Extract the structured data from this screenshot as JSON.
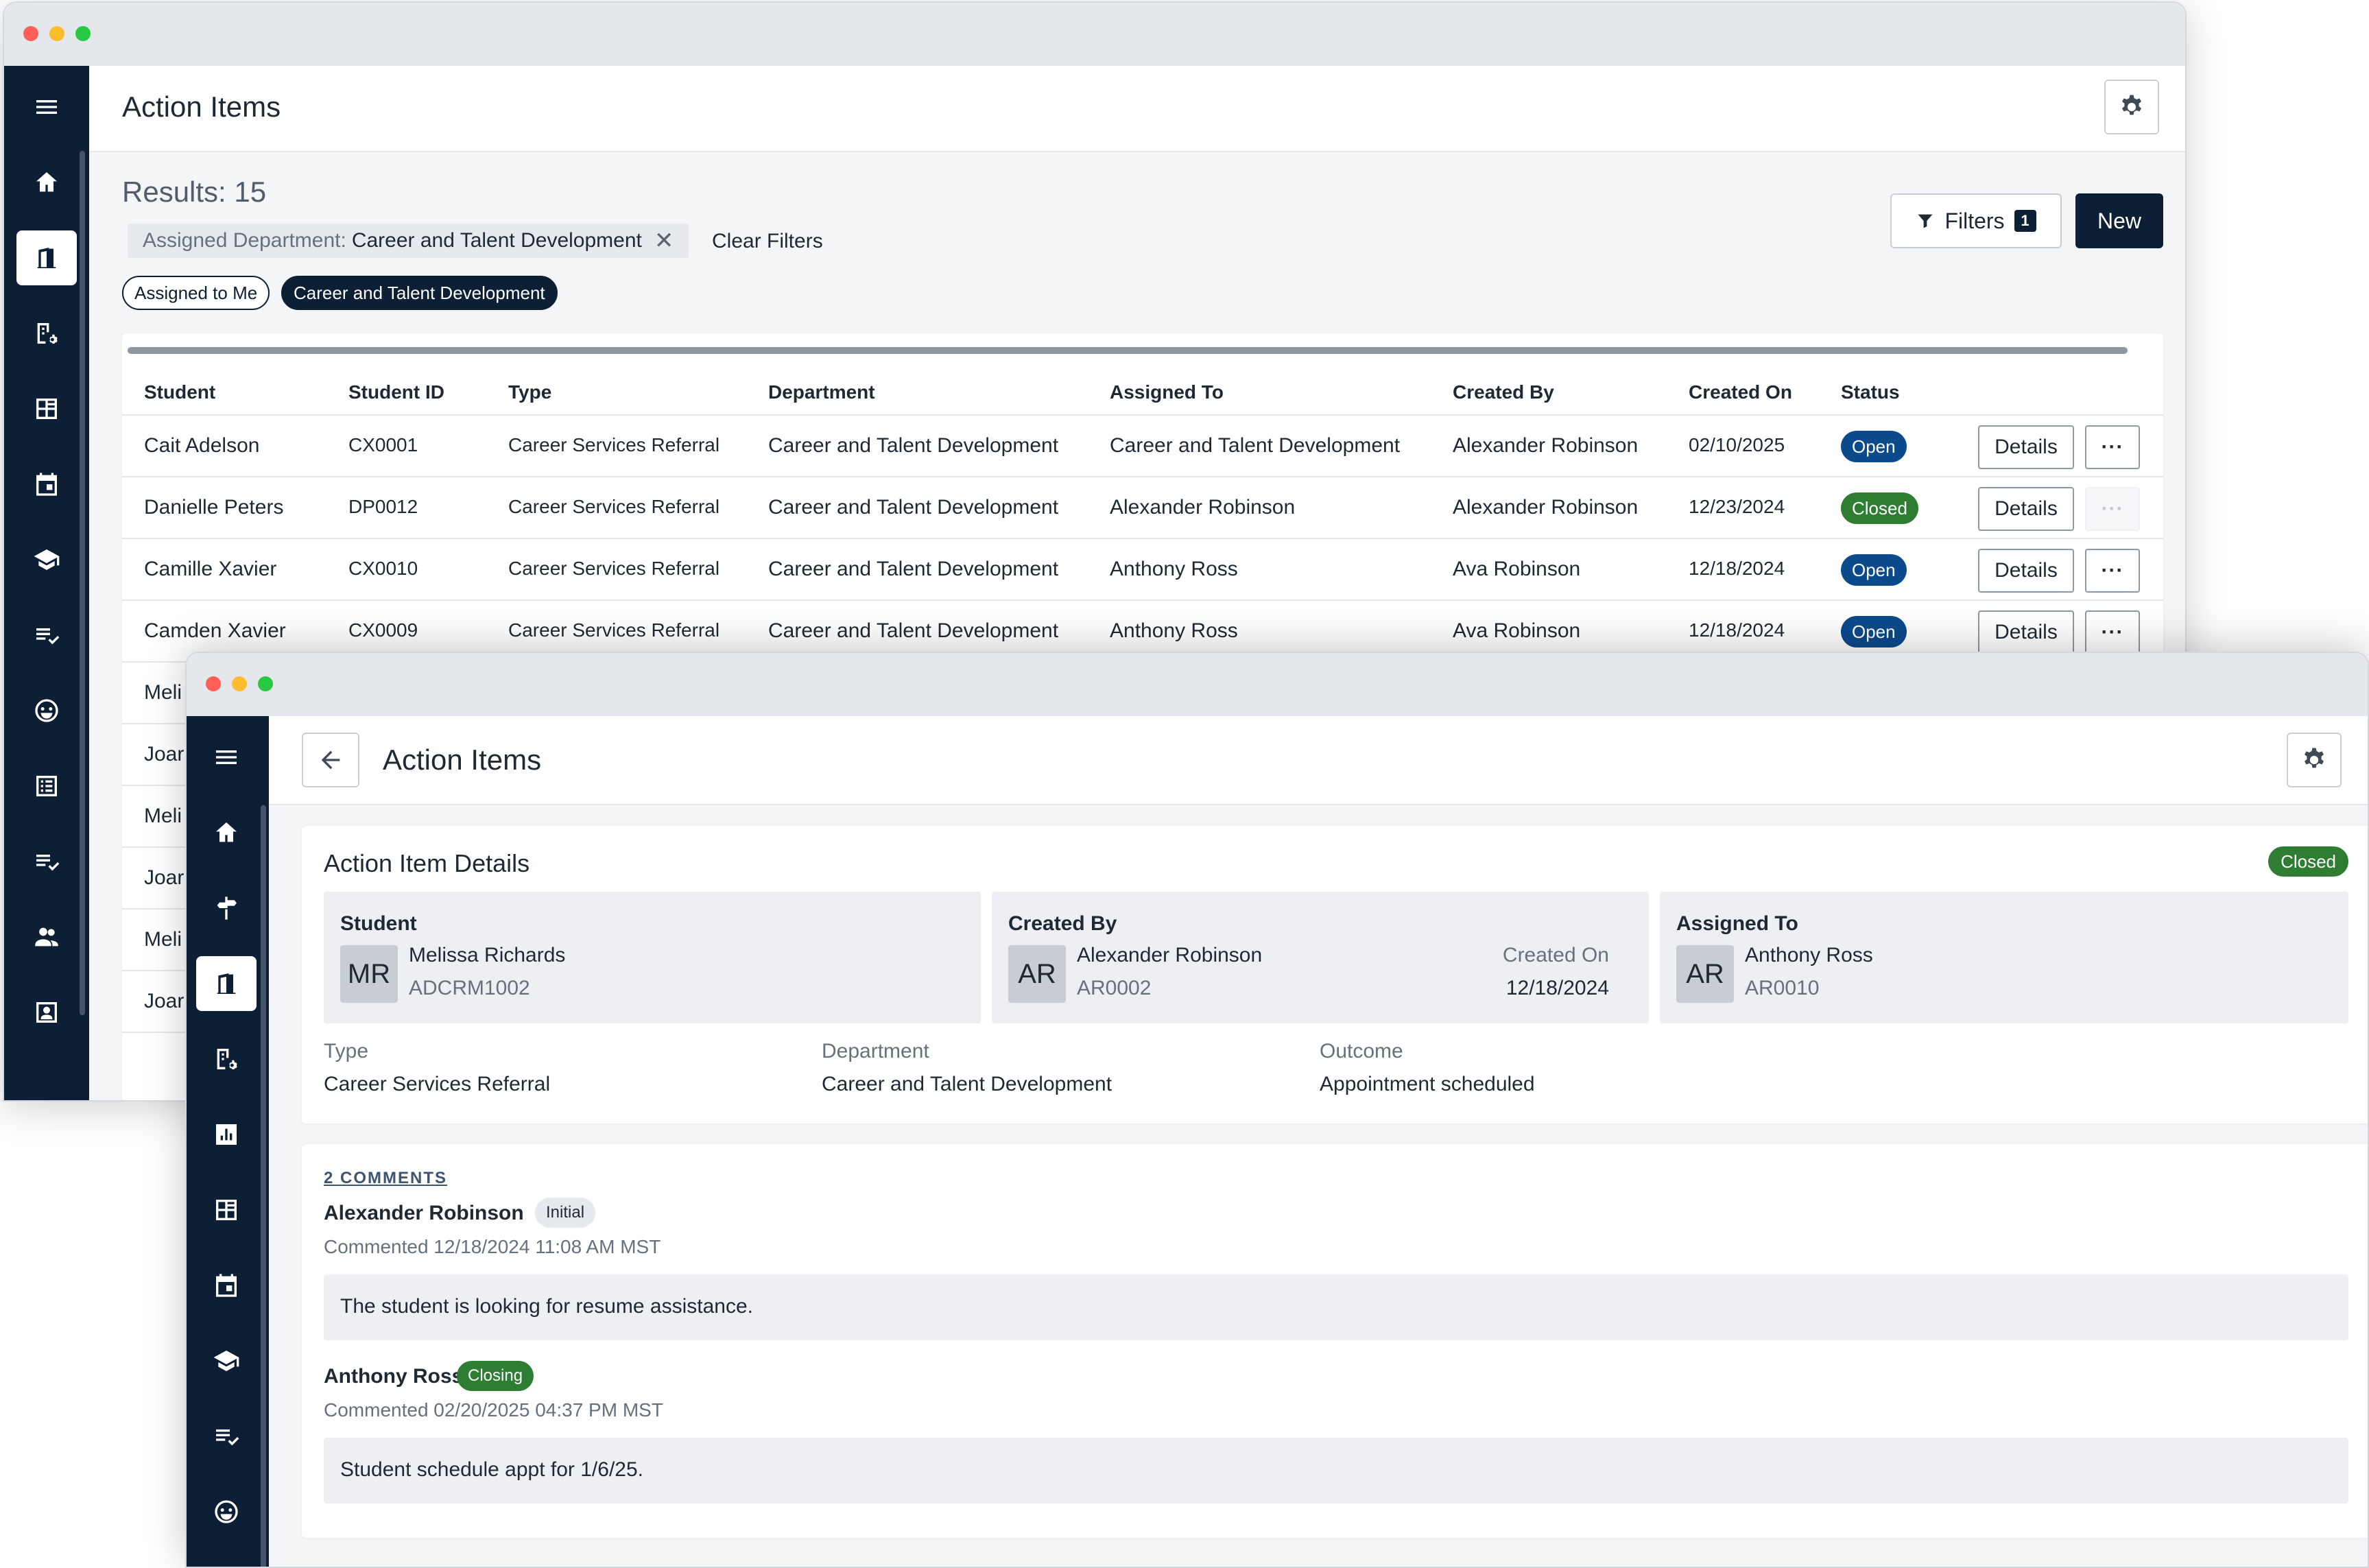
{
  "list_window": {
    "title": "Action Items",
    "results_label": "Results: 15",
    "active_filter": {
      "key": "Assigned Department:",
      "value": "Career and Talent Development",
      "remove_glyph": "✕"
    },
    "clear_filters_label": "Clear Filters",
    "quick_filters": [
      "Assigned to Me",
      "Career and Talent Development"
    ],
    "filters_button": {
      "label": "Filters",
      "count": "1"
    },
    "new_button_label": "New",
    "table": {
      "columns": [
        "Student",
        "Student ID",
        "Type",
        "Department",
        "Assigned To",
        "Created By",
        "Created On",
        "Status"
      ],
      "rows": [
        {
          "student": "Cait Adelson",
          "id": "CX0001",
          "type": "Career Services Referral",
          "department": "Career and Talent Development",
          "assigned_to": "Career and Talent Development",
          "created_by": "Alexander Robinson",
          "created_on": "02/10/2025",
          "status": "Open",
          "more_enabled": true
        },
        {
          "student": "Danielle Peters",
          "id": "DP0012",
          "type": "Career Services Referral",
          "department": "Career and Talent Development",
          "assigned_to": "Alexander Robinson",
          "created_by": "Alexander Robinson",
          "created_on": "12/23/2024",
          "status": "Closed",
          "more_enabled": false
        },
        {
          "student": "Camille Xavier",
          "id": "CX0010",
          "type": "Career Services Referral",
          "department": "Career and Talent Development",
          "assigned_to": "Anthony Ross",
          "created_by": "Ava Robinson",
          "created_on": "12/18/2024",
          "status": "Open",
          "more_enabled": true
        },
        {
          "student": "Camden Xavier",
          "id": "CX0009",
          "type": "Career Services Referral",
          "department": "Career and Talent Development",
          "assigned_to": "Anthony Ross",
          "created_by": "Ava Robinson",
          "created_on": "12/18/2024",
          "status": "Open",
          "more_enabled": true
        },
        {
          "student": "Meli"
        },
        {
          "student": "Joar"
        },
        {
          "student": "Meli"
        },
        {
          "student": "Joar"
        },
        {
          "student": "Meli"
        },
        {
          "student": "Joar"
        }
      ],
      "details_label": "Details",
      "more_label": "···"
    },
    "sidebar_icons": [
      "menu-icon",
      "home-icon",
      "door-icon",
      "building-gear-icon",
      "dashboard-icon",
      "calendar-icon",
      "graduation-cap-icon",
      "checklist-icon",
      "smiley-icon",
      "list-icon",
      "checklist-icon",
      "people-icon",
      "contact-card-icon"
    ]
  },
  "detail_window": {
    "title": "Action Items",
    "card_title": "Action Item Details",
    "status": "Closed",
    "student": {
      "label": "Student",
      "initials": "MR",
      "name": "Melissa Richards",
      "id": "ADCRM1002"
    },
    "created_by": {
      "label": "Created By",
      "initials": "AR",
      "name": "Alexander Robinson",
      "id": "AR0002",
      "created_on_label": "Created On",
      "created_on": "12/18/2024"
    },
    "assigned_to": {
      "label": "Assigned To",
      "initials": "AR",
      "name": "Anthony Ross",
      "id": "AR0010"
    },
    "fields": [
      {
        "label": "Type",
        "value": "Career Services Referral"
      },
      {
        "label": "Department",
        "value": "Career and Talent Development"
      },
      {
        "label": "Outcome",
        "value": "Appointment scheduled"
      }
    ],
    "comments_heading": "2 COMMENTS",
    "comments": [
      {
        "author": "Alexander Robinson",
        "tag": "Initial",
        "meta": "Commented 12/18/2024 11:08 AM MST",
        "body": "The student is looking for resume assistance."
      },
      {
        "author": "Anthony Ross",
        "tag": "Closing",
        "meta": "Commented 02/20/2025 04:37 PM MST",
        "body": "Student schedule appt for 1/6/25."
      }
    ],
    "sidebar_icons": [
      "menu-icon",
      "home-icon",
      "signpost-icon",
      "door-icon",
      "building-gear-icon",
      "bar-chart-icon",
      "dashboard-icon",
      "calendar-icon",
      "graduation-cap-icon",
      "checklist-icon",
      "smiley-icon"
    ]
  },
  "colors": {
    "navy": "#0d1f35",
    "open_badge": "#0b4a8b",
    "closed_badge": "#2e7d32",
    "background": "#f4f5f7"
  }
}
